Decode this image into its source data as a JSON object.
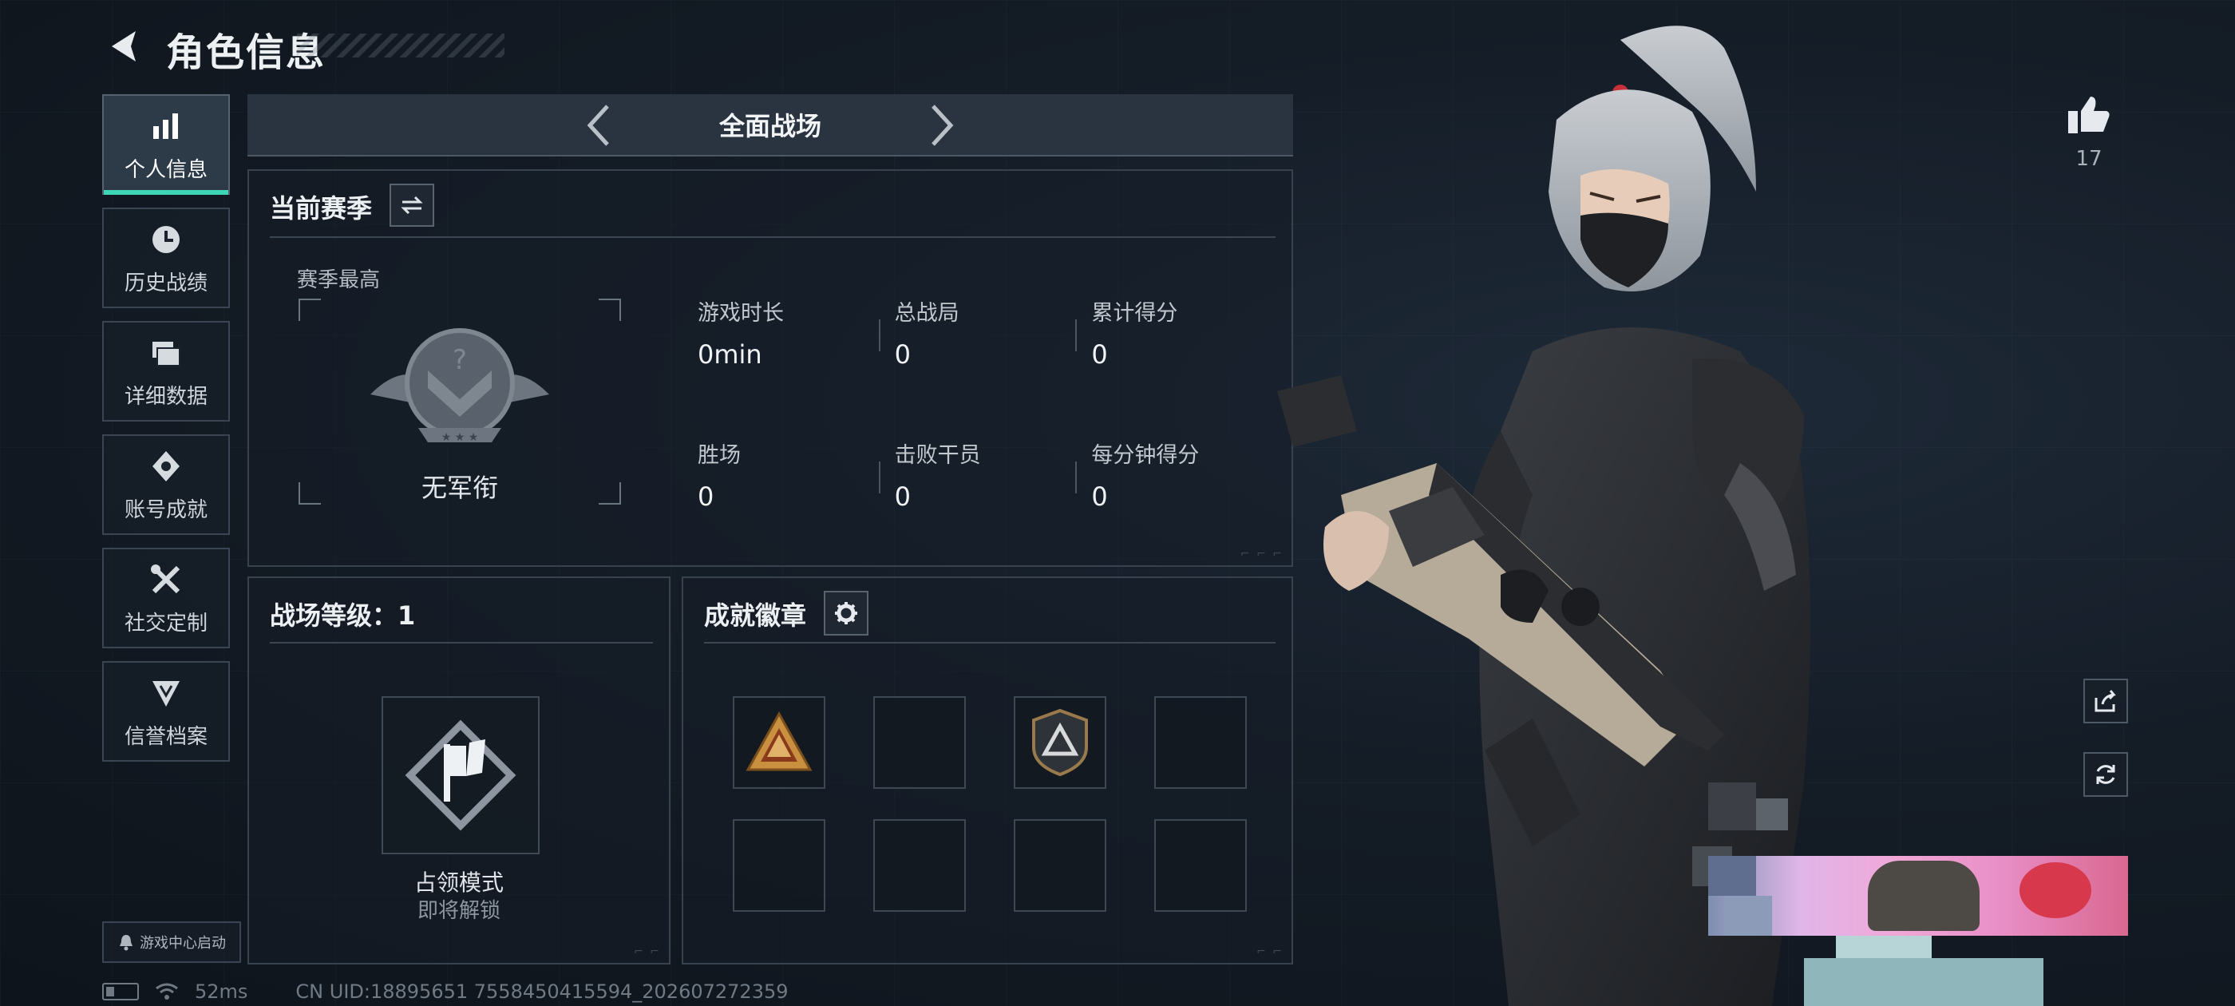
{
  "header": {
    "title": "角色信息"
  },
  "sidebar": {
    "items": [
      {
        "label": "个人信息",
        "icon": "bar-chart-icon",
        "active": true
      },
      {
        "label": "历史战绩",
        "icon": "history-clock-icon",
        "active": false
      },
      {
        "label": "详细数据",
        "icon": "folder-icon",
        "active": false
      },
      {
        "label": "账号成就",
        "icon": "achievement-icon",
        "active": false
      },
      {
        "label": "社交定制",
        "icon": "tools-icon",
        "active": false
      },
      {
        "label": "信誉档案",
        "icon": "reputation-icon",
        "active": false
      }
    ],
    "game_center_label": "游戏中心启动"
  },
  "mode_switcher": {
    "title": "全面战场"
  },
  "season": {
    "title": "当前赛季",
    "best_label": "赛季最高",
    "rank_name": "无军衔",
    "stats": [
      {
        "label": "游戏时长",
        "value": "0min"
      },
      {
        "label": "总战局",
        "value": "0"
      },
      {
        "label": "累计得分",
        "value": "0"
      },
      {
        "label": "胜场",
        "value": "0"
      },
      {
        "label": "击败干员",
        "value": "0"
      },
      {
        "label": "每分钟得分",
        "value": "0"
      }
    ]
  },
  "battlefield_level": {
    "title": "战场等级：1",
    "mode_name": "占领模式",
    "mode_status": "即将解锁"
  },
  "badges": {
    "title": "成就徽章",
    "slots": [
      "warning-triangle-badge",
      "empty",
      "shield-triangle-badge",
      "empty",
      "empty",
      "empty",
      "empty",
      "empty"
    ]
  },
  "social": {
    "likes": "17"
  },
  "status_bar": {
    "ping": "52ms",
    "uid": "CN UID:18895651 7558450415594_202607272359"
  },
  "colors": {
    "accent": "#3ed6b6",
    "panel_border": "#38424f",
    "badge_gold": "#c9903f"
  }
}
